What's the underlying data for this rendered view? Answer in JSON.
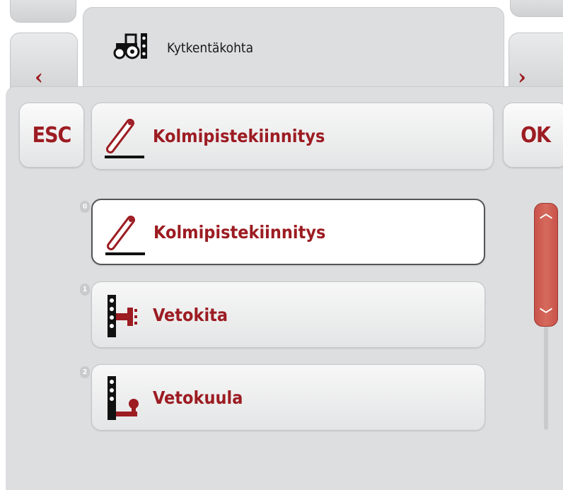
{
  "header": {
    "title": "Kytkentäkohta",
    "icon": "tractor-icon"
  },
  "nav": {
    "prev_label": "‹",
    "next_label": "›"
  },
  "dialog": {
    "esc_label": "ESC",
    "ok_label": "OK",
    "selected_value": "Kolmipistekiinnitys",
    "selected_icon": "three-point-hitch-icon"
  },
  "options": [
    {
      "index": "0",
      "label": "Kolmipistekiinnitys",
      "icon": "three-point-hitch-icon",
      "active": true
    },
    {
      "index": "1",
      "label": "Vetokita",
      "icon": "drawbar-clevis-icon",
      "active": false
    },
    {
      "index": "2",
      "label": "Vetokuula",
      "icon": "tow-ball-icon",
      "active": false
    }
  ],
  "scrollbar": {
    "up_label": "︿",
    "down_label": "﹀",
    "position_fraction": 0,
    "visible_fraction": 0.6
  },
  "colors": {
    "accent": "#9c1c22",
    "panel": "#dddee0",
    "scroll_thumb": "#d0584f"
  }
}
